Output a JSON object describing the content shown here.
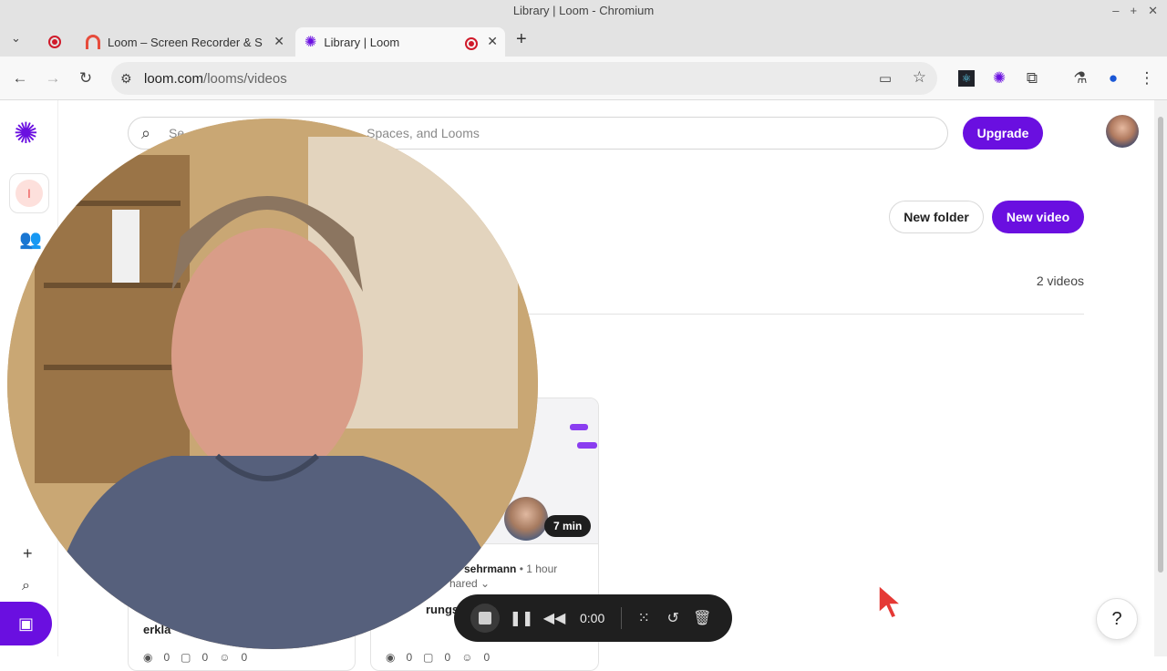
{
  "window": {
    "title": "Library | Loom - Chromium"
  },
  "tabs": [
    {
      "label": "Loom – Screen Recorder & Sc",
      "active": false
    },
    {
      "label": "Library | Loom",
      "active": true
    }
  ],
  "address": {
    "host": "loom.com",
    "path": "/looms/videos"
  },
  "sidebar": {
    "workspace_initial": "I"
  },
  "search": {
    "placeholder_start": "Se",
    "placeholder_end": "Spaces, and Looms"
  },
  "header": {
    "upgrade_label": "Upgrade"
  },
  "actions": {
    "new_folder_label": "New folder",
    "new_video_label": "New video"
  },
  "library": {
    "video_count": "2 videos"
  },
  "cards": [
    {
      "title_partial": "erkla",
      "stats": [
        "0",
        "0",
        "0"
      ]
    },
    {
      "author_partial": "sehrmann",
      "time": "1 hour",
      "shared_partial": "hared",
      "title_partial": "rungsre",
      "duration": "7 min",
      "stats": [
        "0",
        "0",
        "0"
      ]
    }
  ],
  "recorder": {
    "elapsed": "0:00"
  },
  "help": {
    "label": "?"
  },
  "colors": {
    "accent": "#6a0fe0",
    "record_red": "#d01a2a"
  }
}
